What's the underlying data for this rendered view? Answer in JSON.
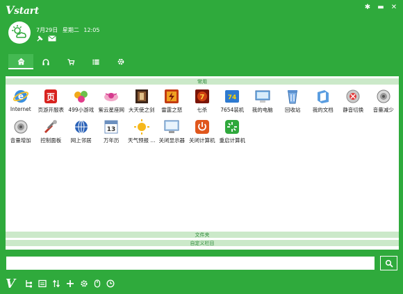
{
  "app": {
    "title": "start",
    "title_initial": "V",
    "brand_color": "#2faa3c",
    "win_controls": [
      "bug-icon",
      "minimize-icon",
      "close-icon"
    ]
  },
  "header": {
    "date": "7月29日",
    "weekday": "星期二",
    "time": "12:05",
    "weather_icon": "cloudy-sun-icon",
    "quick_icons": [
      "pin-icon",
      "mail-icon"
    ]
  },
  "tabs": [
    {
      "name": "home-icon",
      "active": true
    },
    {
      "name": "headphones-icon",
      "active": false
    },
    {
      "name": "cart-icon",
      "active": false
    },
    {
      "name": "list-icon",
      "active": false
    },
    {
      "name": "gear-icon",
      "active": false
    }
  ],
  "sections": {
    "common": "常用",
    "files": "文件夹",
    "custom": "自定义栏目"
  },
  "apps": [
    {
      "label": "Internet",
      "icon": "internet-explorer-icon"
    },
    {
      "label": "页游开服表",
      "icon": "game-server-icon"
    },
    {
      "label": "499小游戏",
      "icon": "mini-games-icon"
    },
    {
      "label": "紫云星座网",
      "icon": "horoscope-icon"
    },
    {
      "label": "大天使之剑",
      "icon": "archangel-game-icon"
    },
    {
      "label": "雷霆之怒",
      "icon": "thunder-game-icon"
    },
    {
      "label": "七杀",
      "icon": "seven-kills-game-icon"
    },
    {
      "label": "7654装机",
      "icon": "install-7654-icon"
    },
    {
      "label": "我的电脑",
      "icon": "my-computer-icon"
    },
    {
      "label": "回收站",
      "icon": "recycle-bin-icon"
    },
    {
      "label": "我的文档",
      "icon": "my-documents-icon"
    },
    {
      "label": "静音切换",
      "icon": "mute-toggle-icon"
    },
    {
      "label": "音量减少",
      "icon": "volume-down-icon"
    },
    {
      "label": "音量增加",
      "icon": "volume-up-icon"
    },
    {
      "label": "控制面板",
      "icon": "control-panel-icon"
    },
    {
      "label": "网上邻居",
      "icon": "network-icon"
    },
    {
      "label": "万年历",
      "icon": "calendar-icon"
    },
    {
      "label": "天气预报 ...",
      "icon": "weather-icon"
    },
    {
      "label": "关闭显示器",
      "icon": "monitor-off-icon"
    },
    {
      "label": "关闭计算机",
      "icon": "shutdown-icon"
    },
    {
      "label": "重启计算机",
      "icon": "restart-icon"
    }
  ],
  "search": {
    "value": "",
    "icon": "search-icon"
  },
  "bottom_toolbar": {
    "logo": "V",
    "icons": [
      "tree-icon",
      "screen-icon",
      "sort-icon",
      "add-icon",
      "settings-icon",
      "mouse-icon",
      "clock-icon"
    ]
  }
}
